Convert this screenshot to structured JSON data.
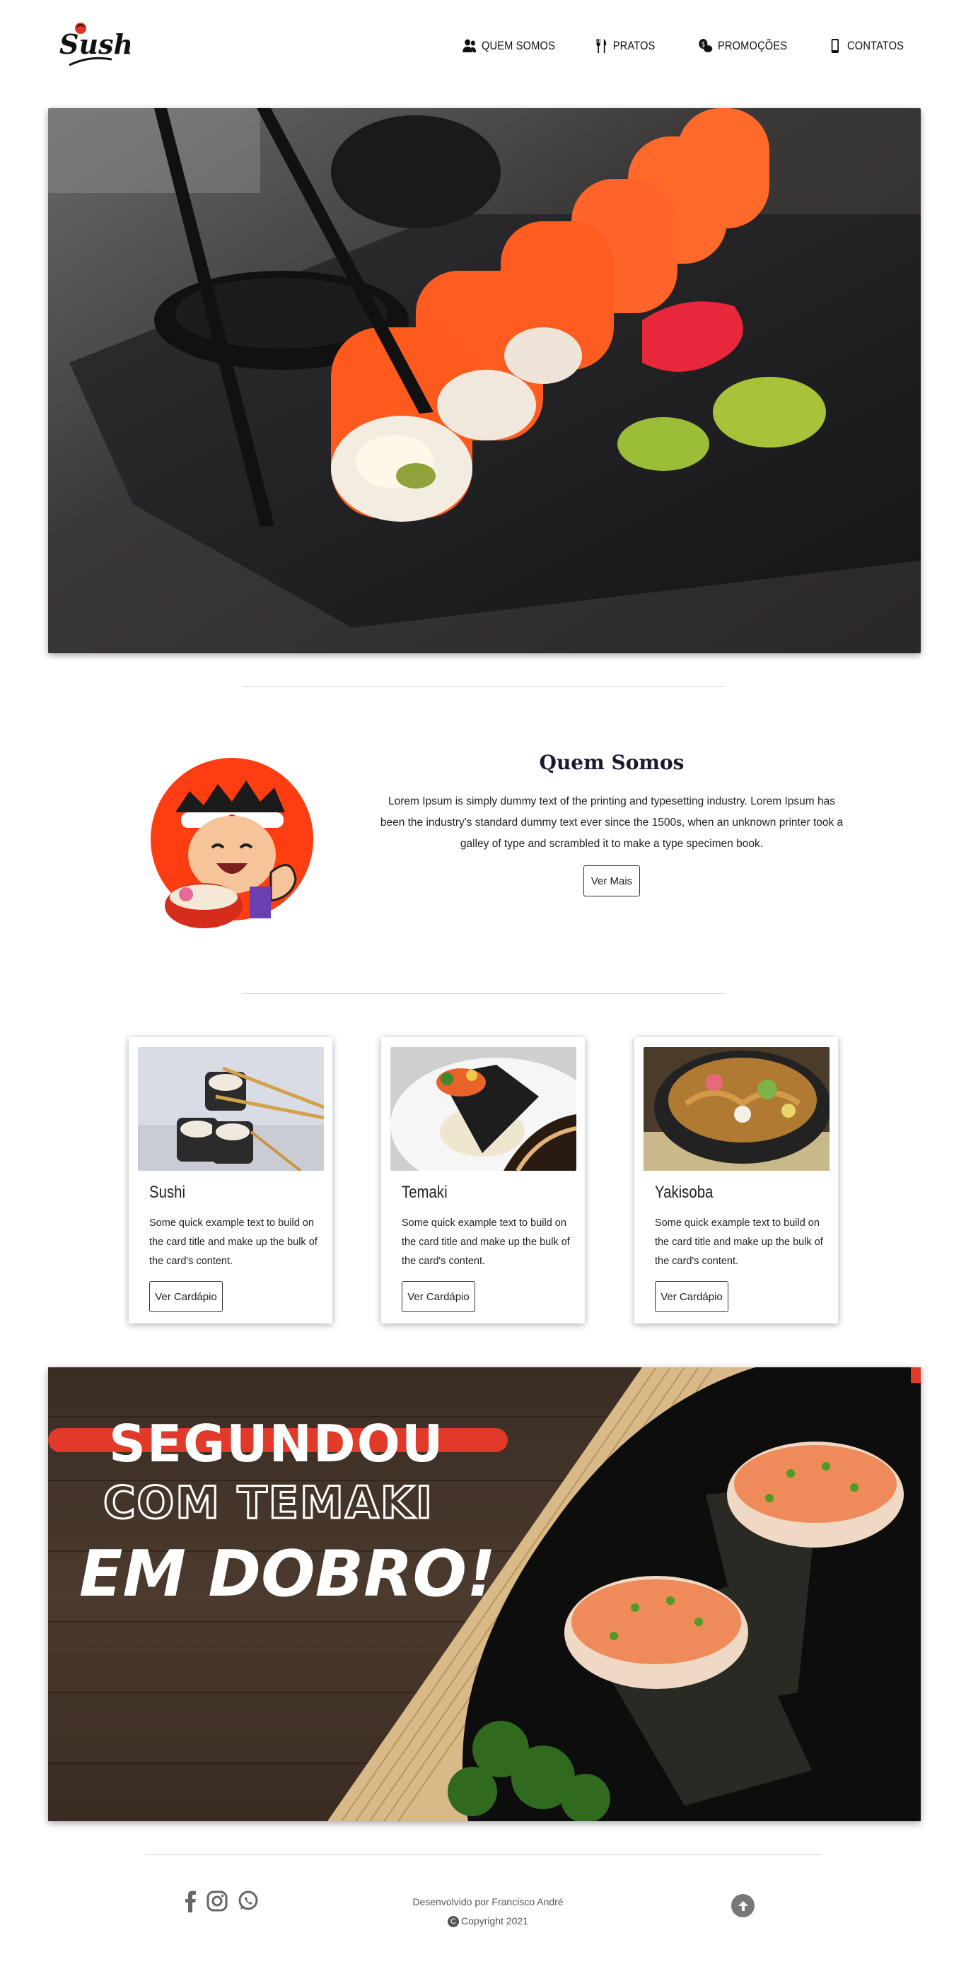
{
  "brand": {
    "logo_text": "Sushi"
  },
  "nav": {
    "items": [
      {
        "label": "QUEM SOMOS",
        "icon": "users-icon"
      },
      {
        "label": "PRATOS",
        "icon": "utensils-icon"
      },
      {
        "label": "PROMOÇÕES",
        "icon": "coins-icon"
      },
      {
        "label": "CONTATOS",
        "icon": "mobile-icon"
      }
    ]
  },
  "hero": {
    "image": "salmon-sushi-rolls-with-chopsticks"
  },
  "about": {
    "title": "Quem Somos",
    "text": "Lorem Ipsum is simply dummy text of the printing and typesetting industry. Lorem Ipsum has been the industry's standard dummy text ever since the 1500s, when an unknown printer took a galley of type and scrambled it to make a type specimen book.",
    "button": "Ver Mais",
    "image": "sushi-chef-mascot"
  },
  "cards": [
    {
      "title": "Sushi",
      "text": "Some quick example text to build on the card title and make up the bulk of the card's content.",
      "button": "Ver Cardápio",
      "image": "sushi-rolls"
    },
    {
      "title": "Temaki",
      "text": "Some quick example text to build on the card title and make up the bulk of the card's content.",
      "button": "Ver Cardápio",
      "image": "temaki-plate"
    },
    {
      "title": "Yakisoba",
      "text": "Some quick example text to build on the card title and make up the bulk of the card's content.",
      "button": "Ver Cardápio",
      "image": "yakisoba-bowl"
    }
  ],
  "promo": {
    "line1": "SEGUNDOU",
    "line2": "COM TEMAKI",
    "line3": "EM DOBRO!",
    "accent_color": "#e23a2a"
  },
  "footer": {
    "social": [
      "facebook-icon",
      "instagram-icon",
      "whatsapp-icon"
    ],
    "developed_by": "Desenvolvido por Francisco André",
    "copyright": "Copyright 2021",
    "back_to_top": "arrow-up-icon"
  }
}
